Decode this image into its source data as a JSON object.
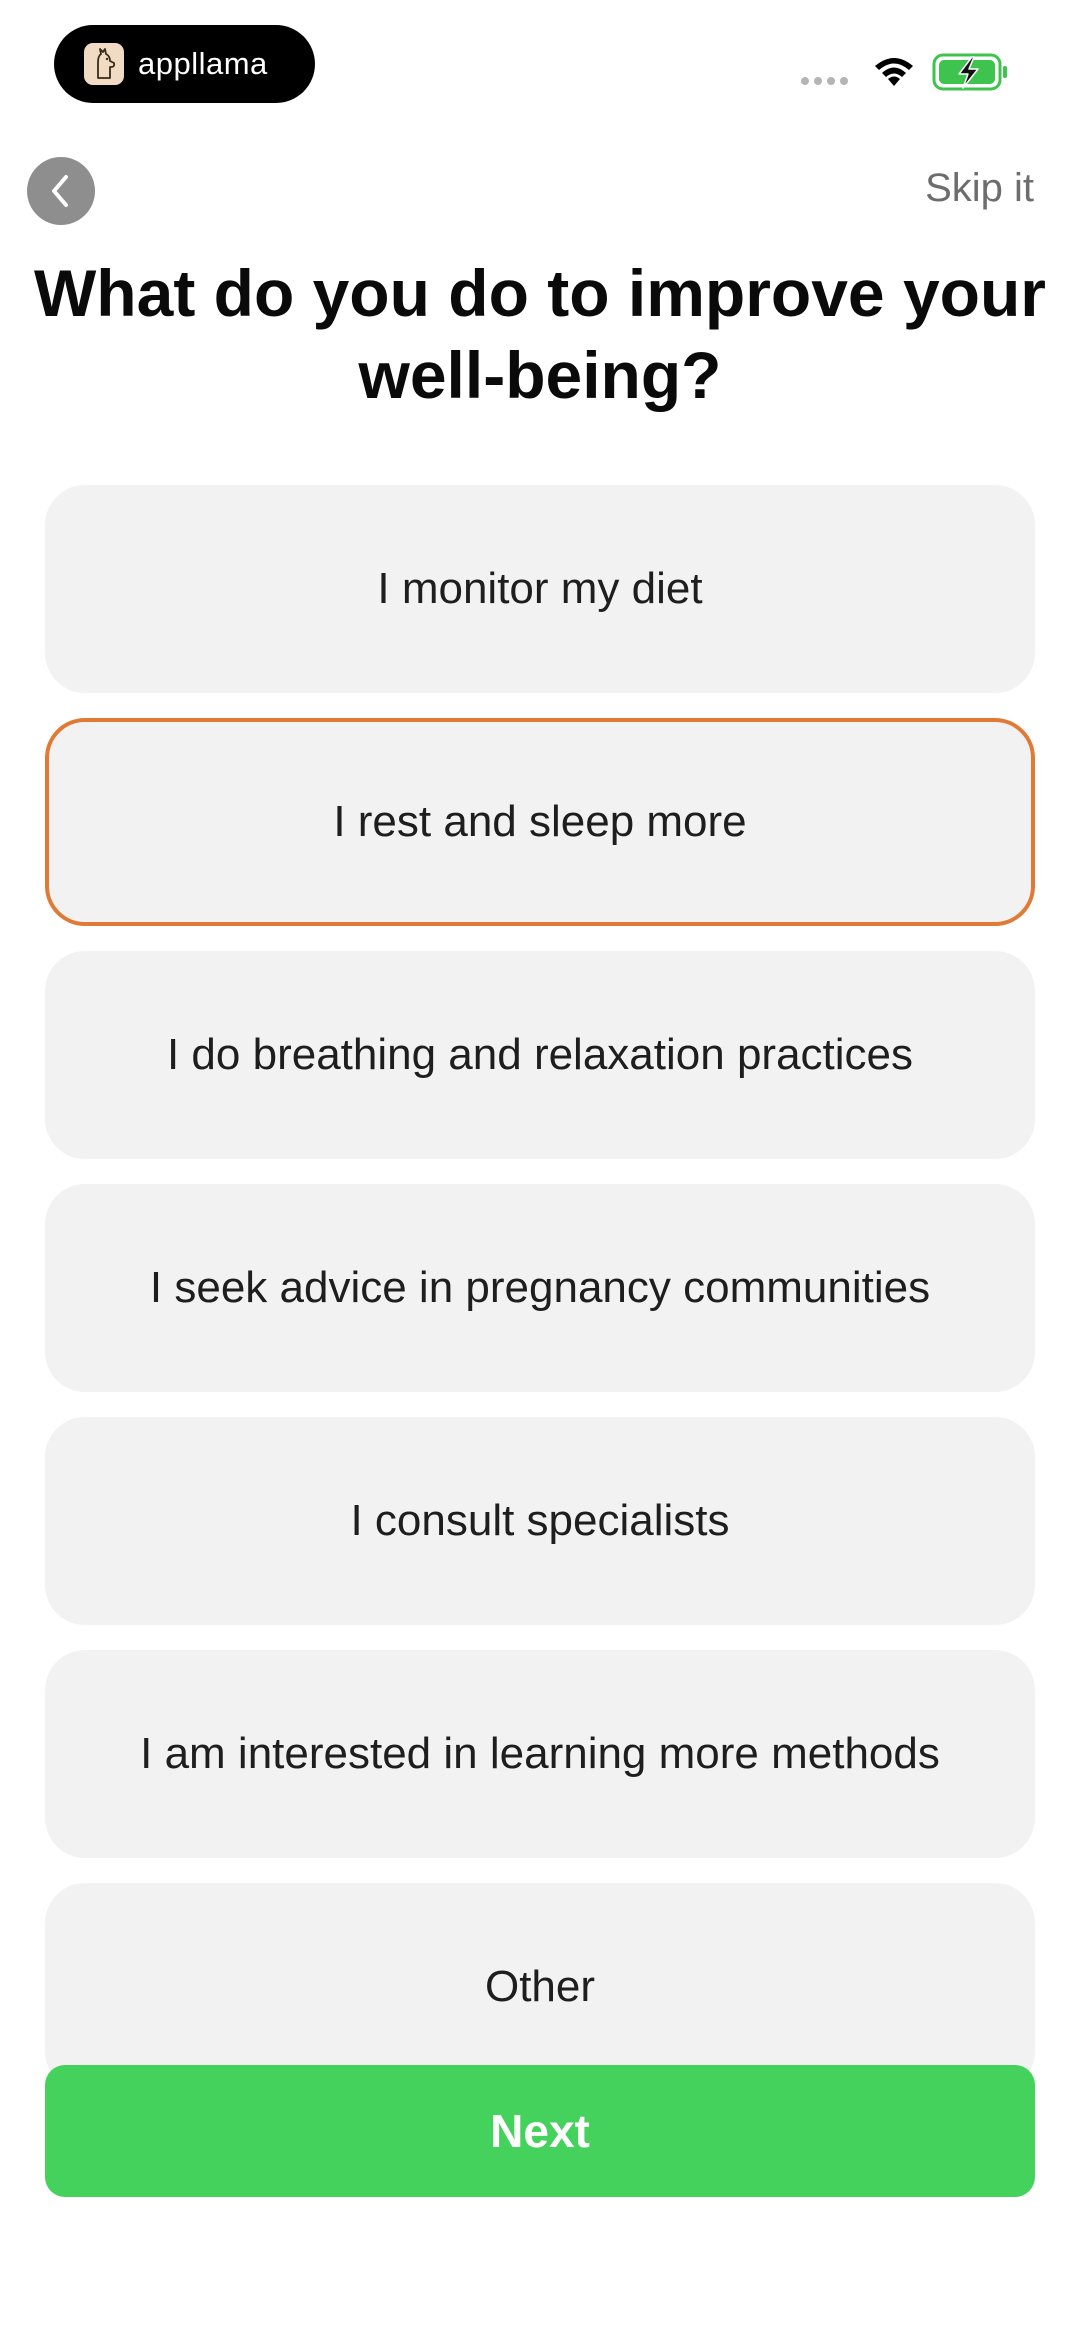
{
  "status_bar": {
    "brand_name": "appllama",
    "icons": [
      "cellular-signal-icon",
      "wifi-icon",
      "battery-charging-icon"
    ]
  },
  "nav": {
    "back_icon": "chevron-left-icon",
    "skip_label": "Skip it"
  },
  "title": "What do you do to improve your well-being?",
  "options": [
    {
      "label": "I monitor my diet",
      "selected": false
    },
    {
      "label": "I rest and sleep more",
      "selected": true
    },
    {
      "label": "I do breathing and relaxation practices",
      "selected": false
    },
    {
      "label": "I seek advice in pregnancy communities",
      "selected": false
    },
    {
      "label": "I consult specialists",
      "selected": false
    },
    {
      "label": "I am interested in learning more methods",
      "selected": false
    },
    {
      "label": "Other",
      "selected": false
    }
  ],
  "next_label": "Next",
  "colors": {
    "accent_selected": "#e07a34",
    "primary_button": "#44d15c",
    "option_background": "#f2f2f2",
    "battery_fill": "#3ec34f"
  }
}
